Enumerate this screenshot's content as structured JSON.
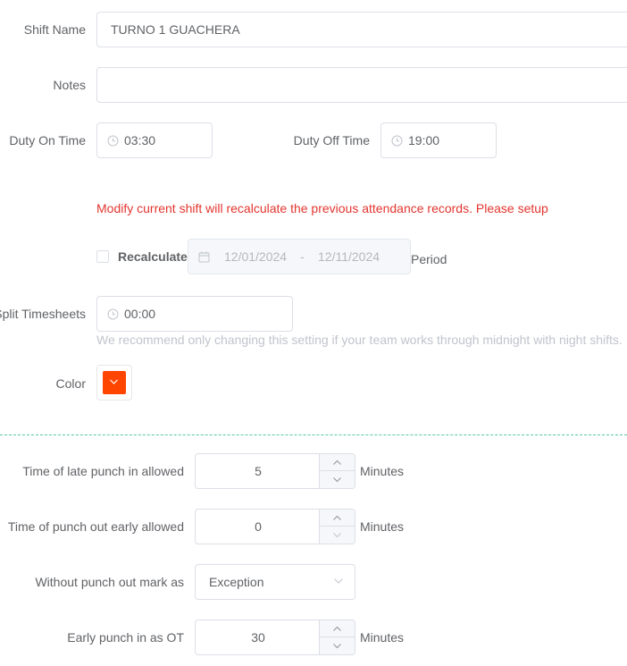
{
  "shift_name": {
    "label": "Shift Name",
    "value": "TURNO 1 GUACHERA"
  },
  "notes": {
    "label": "Notes",
    "value": ""
  },
  "duty_on": {
    "label": "Duty On Time",
    "value": "03:30"
  },
  "duty_off": {
    "label": "Duty Off Time",
    "value": "19:00"
  },
  "warning": "Modify current shift will recalculate the previous attendance records. Please setup",
  "recalculate": {
    "label": "Recalculate",
    "checked": false,
    "start": "12/01/2024",
    "separator": "-",
    "end": "12/11/2024",
    "suffix": "Period"
  },
  "split": {
    "label": "Split Timesheets",
    "value": "00:00",
    "hint": "We recommend only changing this setting if your team works through midnight with night shifts."
  },
  "color": {
    "label": "Color",
    "value": "#ff4500",
    "icon": "chevron-down-icon"
  },
  "late_in": {
    "label": "Time of late punch in allowed",
    "value": "5",
    "unit": "Minutes"
  },
  "early_out": {
    "label": "Time of punch out early allowed",
    "value": "0",
    "unit": "Minutes"
  },
  "no_punch_out": {
    "label": "Without punch out mark as",
    "value": "Exception"
  },
  "early_ot": {
    "label": "Early punch in as OT",
    "value": "30",
    "unit": "Minutes"
  },
  "colors": {
    "warning": "#e3352f",
    "divider": "#55c99a",
    "border": "#dcdfe6"
  }
}
